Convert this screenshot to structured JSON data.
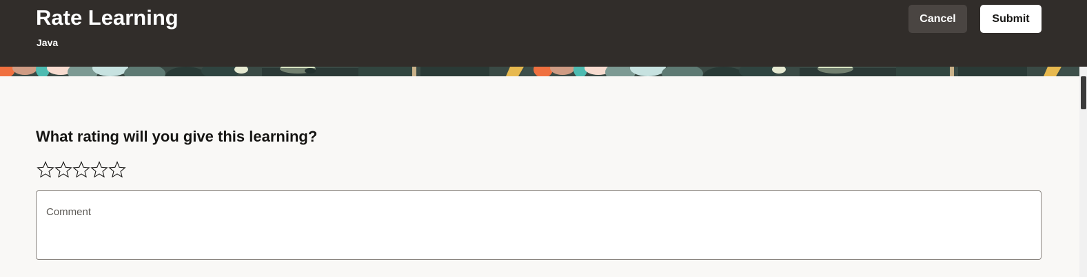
{
  "header": {
    "title": "Rate Learning",
    "subtitle": "Java",
    "cancel_label": "Cancel",
    "submit_label": "Submit",
    "background": "#312d2a"
  },
  "rating": {
    "question": "What rating will you give this learning?",
    "max_stars": 5,
    "selected_stars": 0
  },
  "comment": {
    "label": "Comment",
    "value": ""
  },
  "banner": {
    "colors": [
      "#f0703f",
      "#cf9c84",
      "#4ebbb1",
      "#f7dcd0",
      "#7d9a93",
      "#c7e2e0",
      "#293a36",
      "#d8e6c3",
      "#e7b94f"
    ]
  }
}
